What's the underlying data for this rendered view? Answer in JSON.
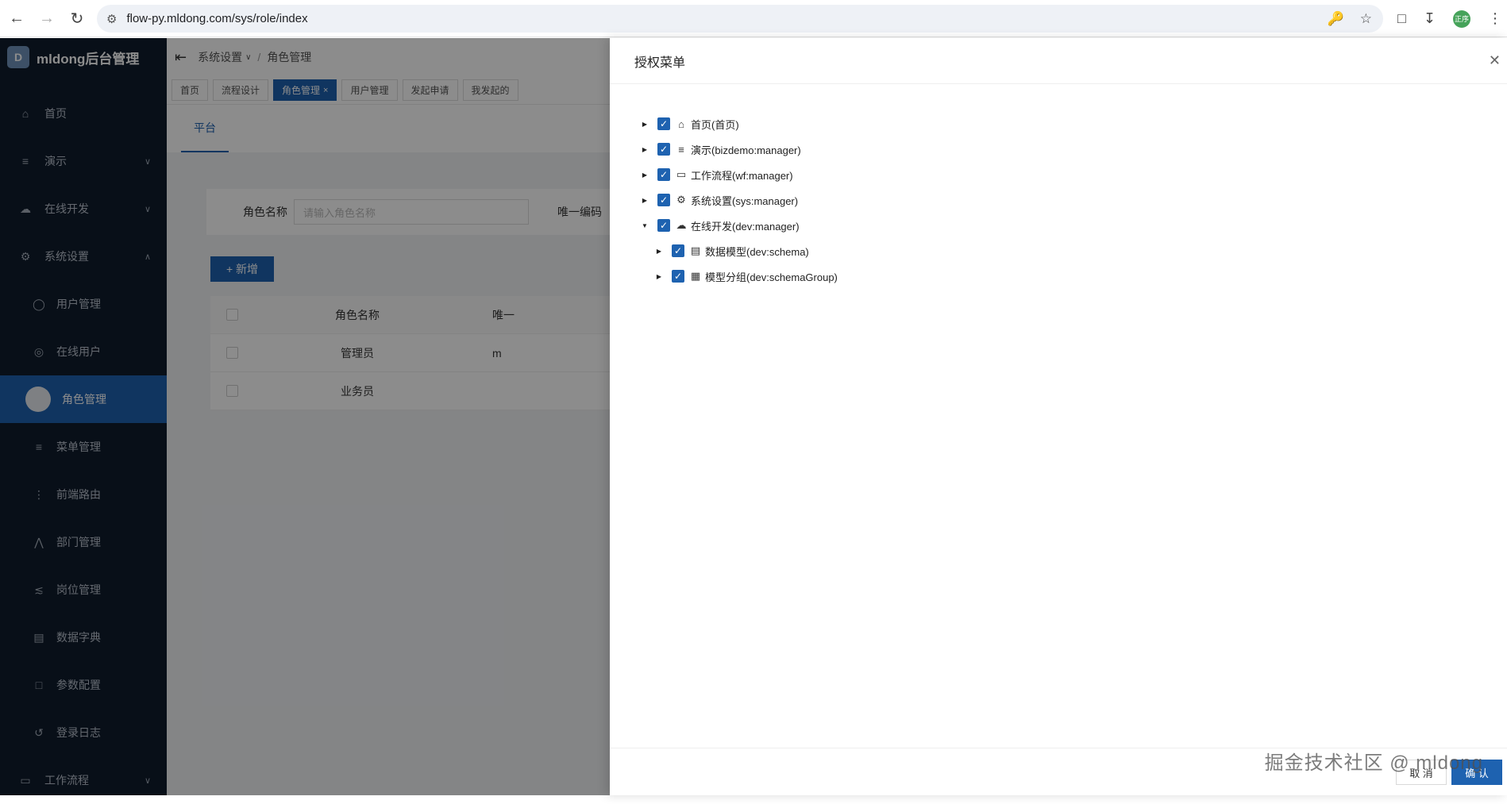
{
  "browser": {
    "url": "flow-py.mldong.com/sys/role/index",
    "profile_text": "正序"
  },
  "app": {
    "logo_letter": "D",
    "title": "mldong后台管理"
  },
  "sidebar": {
    "items": [
      {
        "label": "首页",
        "icon": "home-icon"
      },
      {
        "label": "演示",
        "icon": "list-icon"
      },
      {
        "label": "在线开发",
        "icon": "cloud-icon"
      },
      {
        "label": "系统设置",
        "icon": "gear-icon"
      },
      {
        "label": "用户管理",
        "icon": "user-icon"
      },
      {
        "label": "在线用户",
        "icon": "online-icon"
      },
      {
        "label": "角色管理",
        "icon": "role-icon"
      },
      {
        "label": "菜单管理",
        "icon": "menu-icon"
      },
      {
        "label": "前端路由",
        "icon": "route-icon"
      },
      {
        "label": "部门管理",
        "icon": "dept-icon"
      },
      {
        "label": "岗位管理",
        "icon": "share-icon"
      },
      {
        "label": "数据字典",
        "icon": "dict-icon"
      },
      {
        "label": "参数配置",
        "icon": "config-icon"
      },
      {
        "label": "登录日志",
        "icon": "log-icon"
      },
      {
        "label": "工作流程",
        "icon": "laptop-icon"
      }
    ]
  },
  "breadcrumb": {
    "parent": "系统设置",
    "current": "角色管理"
  },
  "tabs": [
    {
      "label": "首页"
    },
    {
      "label": "流程设计"
    },
    {
      "label": "角色管理"
    },
    {
      "label": "用户管理"
    },
    {
      "label": "发起申请"
    },
    {
      "label": "我发起的"
    }
  ],
  "platform_tab": "平台",
  "search": {
    "role_name_label": "角色名称",
    "role_name_placeholder": "请输入角色名称",
    "code_label": "唯一编码"
  },
  "add_button": "+ 新增",
  "table": {
    "headers": {
      "name": "角色名称",
      "code": "唯一"
    },
    "rows": [
      {
        "name": "管理员",
        "code": "m"
      },
      {
        "name": "业务员",
        "code": ""
      }
    ]
  },
  "drawer": {
    "title": "授权菜单",
    "tree": [
      {
        "label": "首页(首页)",
        "icon": "home-icon",
        "expanded": false,
        "checked": true
      },
      {
        "label": "演示(bizdemo:manager)",
        "icon": "list-icon",
        "expanded": false,
        "checked": true
      },
      {
        "label": "工作流程(wf:manager)",
        "icon": "laptop-icon",
        "expanded": false,
        "checked": true
      },
      {
        "label": "系统设置(sys:manager)",
        "icon": "gear-icon",
        "expanded": false,
        "checked": true
      },
      {
        "label": "在线开发(dev:manager)",
        "icon": "cloud-icon",
        "expanded": true,
        "checked": true
      },
      {
        "label": "数据模型(dev:schema)",
        "icon": "table-icon",
        "expanded": false,
        "checked": true
      },
      {
        "label": "模型分组(dev:schemaGroup)",
        "icon": "group-icon",
        "expanded": false,
        "checked": true
      }
    ],
    "cancel": "取 消",
    "ok": "确 认"
  },
  "watermark": "掘金技术社区 @ mldong"
}
